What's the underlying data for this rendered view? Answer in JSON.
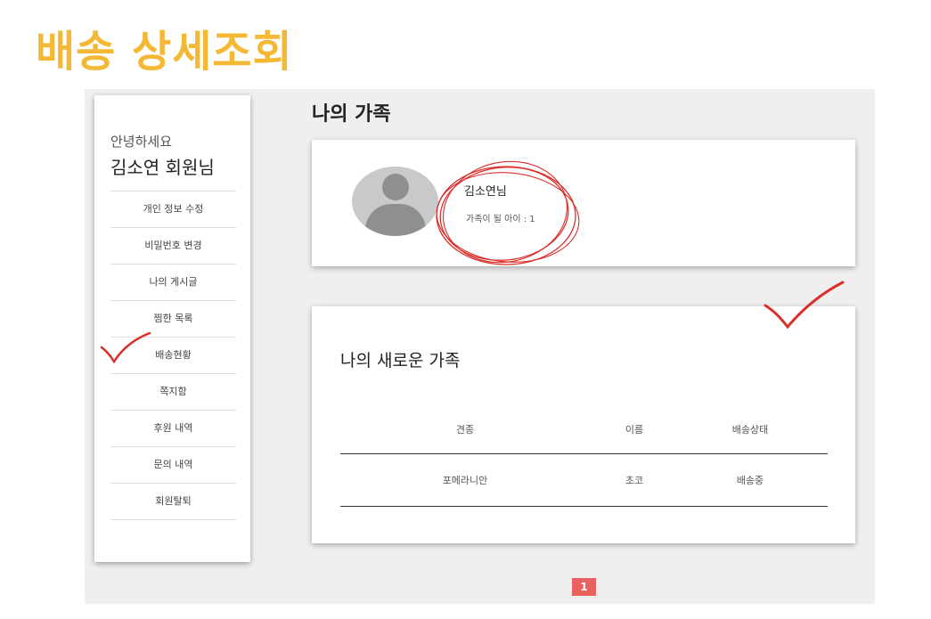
{
  "slide": {
    "title": "배송 상세조회"
  },
  "sidebar": {
    "greeting": "안녕하세요",
    "user_name": "김소연 회원님",
    "items": [
      {
        "label": "개인 정보 수정"
      },
      {
        "label": "비밀번호 변경"
      },
      {
        "label": "나의 게시글"
      },
      {
        "label": "찜한 목록"
      },
      {
        "label": "배송현황"
      },
      {
        "label": "쪽지함"
      },
      {
        "label": "후원 내역"
      },
      {
        "label": "문의 내역"
      },
      {
        "label": "회원탈퇴"
      }
    ]
  },
  "main": {
    "heading": "나의 가족",
    "profile": {
      "name": "김소연님",
      "family_count": "가족이 될 아이 : 1"
    },
    "new_family": {
      "title": "나의 새로운 가족",
      "headers": [
        "견종",
        "이름",
        "배송상태"
      ],
      "rows": [
        [
          "포메라니안",
          "초코",
          "배송중"
        ]
      ]
    },
    "pagination": {
      "current": "1"
    }
  },
  "colors": {
    "title": "#f4b835",
    "annotation": "#d9302b",
    "pager": "#e9625f"
  }
}
